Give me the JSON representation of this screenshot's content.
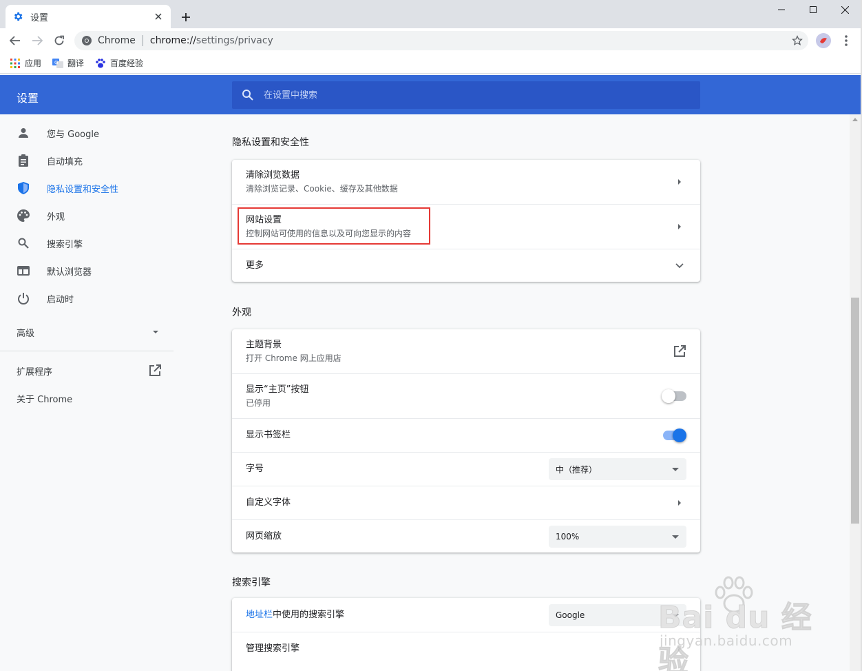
{
  "browser": {
    "tab_title": "设置",
    "omnibox": {
      "scheme": "Chrome",
      "url_host": "chrome://",
      "url_path": "settings/privacy"
    },
    "bookmarks": [
      {
        "label": "应用",
        "icon": "apps-grid-icon"
      },
      {
        "label": "翻译",
        "icon": "translate-icon"
      },
      {
        "label": "百度经验",
        "icon": "baidu-paw-icon"
      }
    ]
  },
  "header": {
    "title": "设置",
    "search_placeholder": "在设置中搜索"
  },
  "sidebar": {
    "items": [
      {
        "label": "您与 Google",
        "icon": "person-icon"
      },
      {
        "label": "自动填充",
        "icon": "clipboard-icon"
      },
      {
        "label": "隐私设置和安全性",
        "icon": "shield-icon"
      },
      {
        "label": "外观",
        "icon": "palette-icon"
      },
      {
        "label": "搜索引擎",
        "icon": "search-icon"
      },
      {
        "label": "默认浏览器",
        "icon": "browser-window-icon"
      },
      {
        "label": "启动时",
        "icon": "power-icon"
      }
    ],
    "active_index": 2,
    "advanced_label": "高级",
    "extensions_label": "扩展程序",
    "about_label": "关于 Chrome"
  },
  "privacy": {
    "section_title": "隐私设置和安全性",
    "clear": {
      "title": "清除浏览数据",
      "subtitle": "清除浏览记录、Cookie、缓存及其他数据"
    },
    "site": {
      "title": "网站设置",
      "subtitle": "控制网站可使用的信息以及可向您显示的内容"
    },
    "more": {
      "title": "更多"
    }
  },
  "appearance": {
    "section_title": "外观",
    "theme": {
      "title": "主题背景",
      "subtitle": "打开 Chrome 网上应用店"
    },
    "home_button": {
      "title": "显示“主页”按钮",
      "subtitle": "已停用",
      "enabled": false
    },
    "bookmarks_bar": {
      "title": "显示书签栏",
      "enabled": true
    },
    "font_size": {
      "title": "字号",
      "value": "中（推荐）"
    },
    "custom_fonts": {
      "title": "自定义字体"
    },
    "zoom": {
      "title": "网页缩放",
      "value": "100%"
    }
  },
  "search_engine": {
    "section_title": "搜索引擎",
    "address_bar": {
      "link": "地址栏",
      "rest": "中使用的搜索引擎",
      "value": "Google"
    },
    "manage": {
      "title": "管理搜索引擎"
    }
  },
  "watermark": {
    "logo": "Bai du 经验",
    "url": "jingyan.baidu.com"
  },
  "colors": {
    "accent": "#1a73e8",
    "header": "#3367d6",
    "highlight": "#e53935"
  }
}
